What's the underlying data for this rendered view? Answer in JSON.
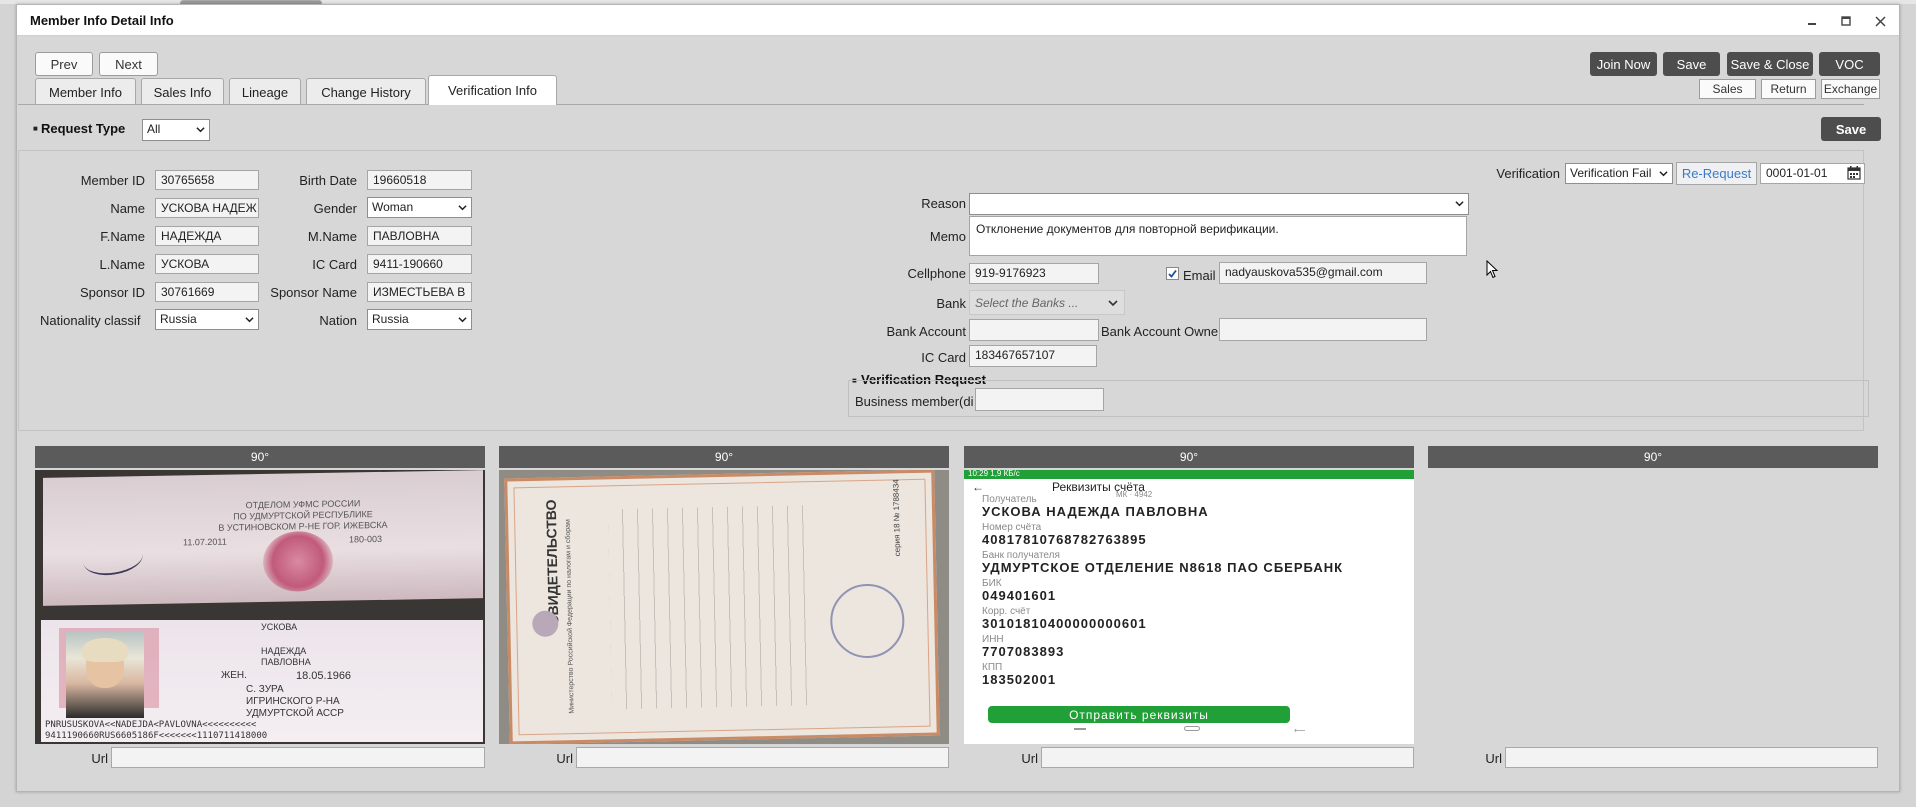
{
  "window": {
    "title": "Member Info Detail Info"
  },
  "nav": {
    "prev": "Prev",
    "next": "Next"
  },
  "actions": {
    "join_now": "Join Now",
    "save": "Save",
    "save_close": "Save & Close",
    "voc": "VOC",
    "sales": "Sales",
    "return": "Return",
    "exchange": "Exchange"
  },
  "tabs": [
    {
      "label": "Member Info"
    },
    {
      "label": "Sales Info"
    },
    {
      "label": "Lineage"
    },
    {
      "label": "Change History"
    },
    {
      "label": "Verification Info",
      "active": true
    }
  ],
  "request_type": {
    "label": "Request Type",
    "value": "All",
    "save": "Save"
  },
  "member": {
    "member_id": {
      "label": "Member ID",
      "value": "30765658"
    },
    "birth_date": {
      "label": "Birth Date",
      "value": "19660518"
    },
    "name": {
      "label": "Name",
      "value": "УСКОВА НАДЕЖ"
    },
    "gender": {
      "label": "Gender",
      "value": "Woman"
    },
    "fname": {
      "label": "F.Name",
      "value": "НАДЕЖДА"
    },
    "mname": {
      "label": "M.Name",
      "value": "ПАВЛОВНА"
    },
    "lname": {
      "label": "L.Name",
      "value": "УСКОВА"
    },
    "ic_card": {
      "label": "IC Card",
      "value": "9411-190660"
    },
    "sponsor_id": {
      "label": "Sponsor ID",
      "value": "30761669"
    },
    "sponsor_name": {
      "label": "Sponsor Name",
      "value": "ИЗМЕСТЬЕВА В"
    },
    "nationality": {
      "label": "Nationality classif",
      "value": "Russia"
    },
    "nation": {
      "label": "Nation",
      "value": "Russia"
    }
  },
  "verification": {
    "label": "Verification",
    "value": "Verification Fail",
    "re_request": "Re-Request",
    "date": "0001-01-01",
    "reason": {
      "label": "Reason",
      "value": ""
    },
    "memo": {
      "label": "Memo",
      "value": "Отклонение документов для повторной верификации."
    },
    "cellphone": {
      "label": "Cellphone",
      "value": "919-9176923"
    },
    "email": {
      "label": "Email",
      "checked": true,
      "value": "nadyauskova535@gmail.com"
    },
    "bank": {
      "label": "Bank",
      "placeholder": "Select the Banks ..."
    },
    "bank_account": {
      "label": "Bank Account",
      "value": ""
    },
    "bank_account_owner": {
      "label": "Bank Account Owne",
      "value": ""
    },
    "ic_card": {
      "label": "IC Card",
      "value": "183467657107"
    }
  },
  "verification_request": {
    "title": "Verification Request",
    "business_member": {
      "label": "Business member(di",
      "value": ""
    }
  },
  "images": [
    {
      "rotate": "90°",
      "url_label": "Url",
      "url": ""
    },
    {
      "rotate": "90°",
      "url_label": "Url",
      "url": ""
    },
    {
      "rotate": "90°",
      "url_label": "Url",
      "url": ""
    },
    {
      "rotate": "90°",
      "url_label": "Url",
      "url": ""
    }
  ],
  "doc_passport": {
    "issuer": [
      "ОТДЕЛОМ УФМС РОССИИ",
      "ПО УДМУРТСКОЙ РЕСПУБЛИКЕ",
      "В УСТИНОВСКОМ Р-НЕ ГОР. ИЖЕВСКА"
    ],
    "issue_date": "11.07.2011",
    "code": "180-003",
    "surname": "УСКОВА",
    "given": "НАДЕЖДА",
    "patronymic": "ПАВЛОВНА",
    "sex": "ЖЕН.",
    "dob": "18.05.1966",
    "place": [
      "С. ЗУРА",
      "ИГРИНСКОГО Р-НА",
      "УДМУРТСКОЙ АССР"
    ],
    "mrz1": "PNRUSUSKOVA<<NADEJDA<PAVLOVNA<<<<<<<<<<",
    "mrz2": "9411190660RUS6605186F<<<<<<<1110711418000"
  },
  "doc_certificate": {
    "title": "СВИДЕТЕЛЬСТВО",
    "serial": "серия 18 № 1788434",
    "ministry": "Министерство Российской Федерации по налогам и сборам"
  },
  "doc_bank": {
    "status": "10:29 1,9 КБ/с",
    "header": "Реквизиты счёта",
    "sub": "МК · 4942",
    "fields": [
      {
        "label": "Получатель",
        "value": "УСКОВА НАДЕЖДА ПАВЛОВНА"
      },
      {
        "label": "Номер счёта",
        "value": "40817810768782763895"
      },
      {
        "label": "Банк получателя",
        "value": "УДМУРТСКОЕ ОТДЕЛЕНИЕ N8618 ПАО СБЕРБАНК"
      },
      {
        "label": "БИК",
        "value": "049401601"
      },
      {
        "label": "Корр. счёт",
        "value": "30101810400000000601"
      },
      {
        "label": "ИНН",
        "value": "7707083893"
      },
      {
        "label": "КПП",
        "value": "183502001"
      }
    ],
    "send_button": "Отправить реквизиты"
  }
}
